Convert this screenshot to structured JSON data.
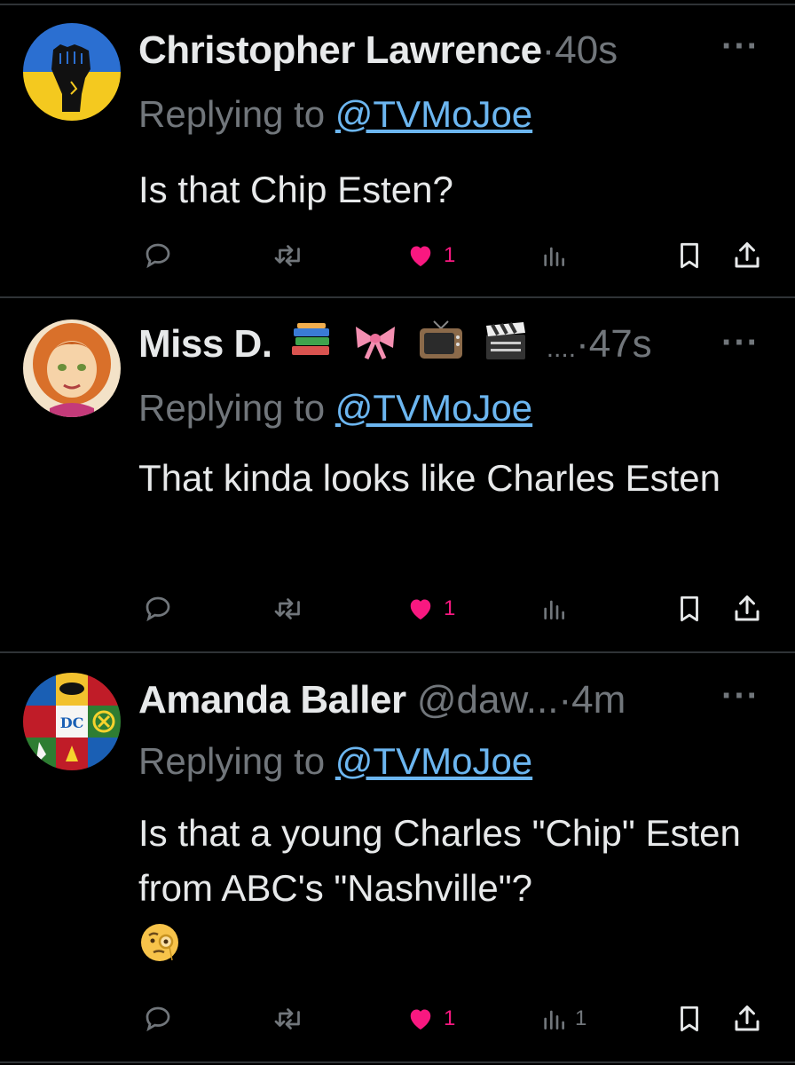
{
  "tweets": [
    {
      "name": "Christopher Lawrence",
      "handle": "",
      "separator": "·",
      "time": "40s",
      "replying_prefix": "Replying to",
      "replying_handle": "@TVMoJoe",
      "text": "Is that Chip Esten?",
      "likes": "1",
      "views": "",
      "more": "···"
    },
    {
      "name": "Miss D.",
      "name_suffix": "....",
      "handle": "",
      "separator": "·",
      "time": "47s",
      "replying_prefix": "Replying to",
      "replying_handle": "@TVMoJoe",
      "text": "That kinda looks like Charles Esten",
      "likes": "1",
      "views": "",
      "more": "···"
    },
    {
      "name": "Amanda Baller",
      "handle": "@daw...",
      "separator": "·",
      "time": "4m",
      "replying_prefix": "Replying to",
      "replying_handle": "@TVMoJoe",
      "text": "Is that a young Charles \"Chip\" Esten from ABC's \"Nashville\"?",
      "likes": "1",
      "views": "1",
      "more": "···"
    }
  ],
  "colors": {
    "background": "#000000",
    "text": "#e7e9ea",
    "muted": "#71767b",
    "link": "#6cb6f0",
    "like": "#f91880",
    "divider": "#2f3336"
  },
  "icons": [
    "reply-icon",
    "retweet-icon",
    "heart-icon",
    "views-icon",
    "bookmark-icon",
    "share-icon"
  ]
}
